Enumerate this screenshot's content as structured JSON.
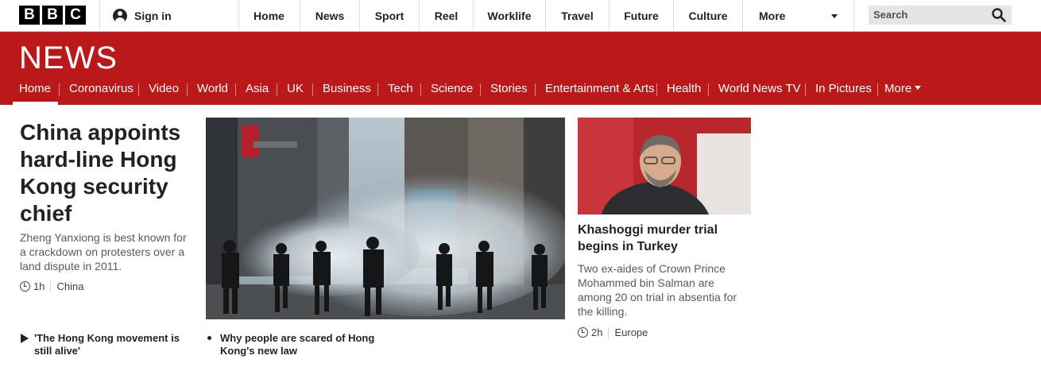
{
  "brand": {
    "letters": [
      "B",
      "B",
      "C"
    ]
  },
  "top_nav": {
    "sign_in": "Sign in",
    "items": [
      "Home",
      "News",
      "Sport",
      "Reel",
      "Worklife",
      "Travel",
      "Future",
      "Culture"
    ],
    "more": "More",
    "search_placeholder": "Search"
  },
  "news_banner": {
    "wordmark": "NEWS",
    "items": [
      "Home",
      "Coronavirus",
      "Video",
      "World",
      "Asia",
      "UK",
      "Business",
      "Tech",
      "Science",
      "Stories",
      "Entertainment & Arts",
      "Health",
      "World News TV",
      "In Pictures"
    ],
    "more": "More",
    "active_item": "Home"
  },
  "lead_story": {
    "headline": "China appoints hard-line Hong Kong security chief",
    "summary": "Zheng Yanxiong is best known for a crackdown on protesters over a land dispute in 2011.",
    "time": "1h",
    "tag": "China"
  },
  "side_story": {
    "headline": "Khashoggi murder trial begins in Turkey",
    "summary": "Two ex-aides of Crown Prince Mohammed bin Salman are among 20 on trial in absentia for the killing.",
    "time": "2h",
    "tag": "Europe"
  },
  "related": [
    {
      "icon": "play-icon",
      "text": "'The Hong Kong movement is still alive'"
    },
    {
      "icon": "bullet-icon",
      "text": "Why people are scared of Hong Kong's new law"
    }
  ],
  "colors": {
    "brand_red": "#bb1919",
    "text": "#222222",
    "summary": "#5a5a5a"
  }
}
